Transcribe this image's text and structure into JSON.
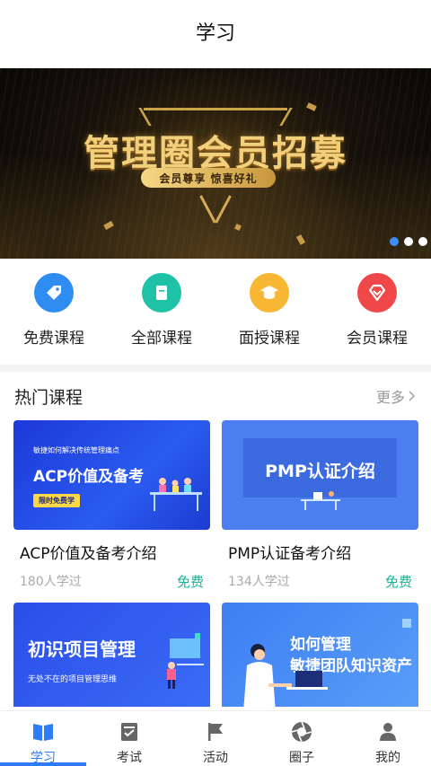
{
  "header": {
    "title": "学习"
  },
  "banner": {
    "title": "管理圈会员招募",
    "subtitle": "会员尊享  惊喜好礼",
    "slide_count": 3,
    "active_slide": 1
  },
  "categories": [
    {
      "label": "免费课程",
      "icon": "tag-icon",
      "color": "#2f8cf0"
    },
    {
      "label": "全部课程",
      "icon": "book-icon",
      "color": "#1fc1a7"
    },
    {
      "label": "面授课程",
      "icon": "graduation-cap-icon",
      "color": "#f7b733"
    },
    {
      "label": "会员课程",
      "icon": "diamond-icon",
      "color": "#f04848"
    }
  ],
  "hot_section": {
    "title": "热门课程",
    "more": "更多"
  },
  "courses": [
    {
      "title": "ACP价值及备考介绍",
      "count": "180人学过",
      "price": "免费",
      "thumb": {
        "line1": "敏捷如何解决传统管理痛点",
        "line2": "ACP价值及备考",
        "tag": "限时免费学"
      }
    },
    {
      "title": "PMP认证备考介绍",
      "count": "134人学过",
      "price": "免费",
      "thumb": {
        "line1": "PMP认证介绍"
      }
    },
    {
      "thumb": {
        "line1": "初识项目管理",
        "line2": "无处不在的项目管理思维"
      }
    },
    {
      "thumb": {
        "line1": "如何管理",
        "line2": "敏捷团队知识资产"
      }
    }
  ],
  "tabbar": {
    "items": [
      {
        "label": "学习",
        "icon": "book-open-icon",
        "active": true
      },
      {
        "label": "考试",
        "icon": "exam-icon",
        "active": false
      },
      {
        "label": "活动",
        "icon": "flag-icon",
        "active": false
      },
      {
        "label": "圈子",
        "icon": "aperture-icon",
        "active": false
      },
      {
        "label": "我的",
        "icon": "user-icon",
        "active": false
      }
    ]
  },
  "colors": {
    "accent": "#2f7cf6",
    "price": "#18b39a",
    "gold": "#f2cf7a"
  }
}
